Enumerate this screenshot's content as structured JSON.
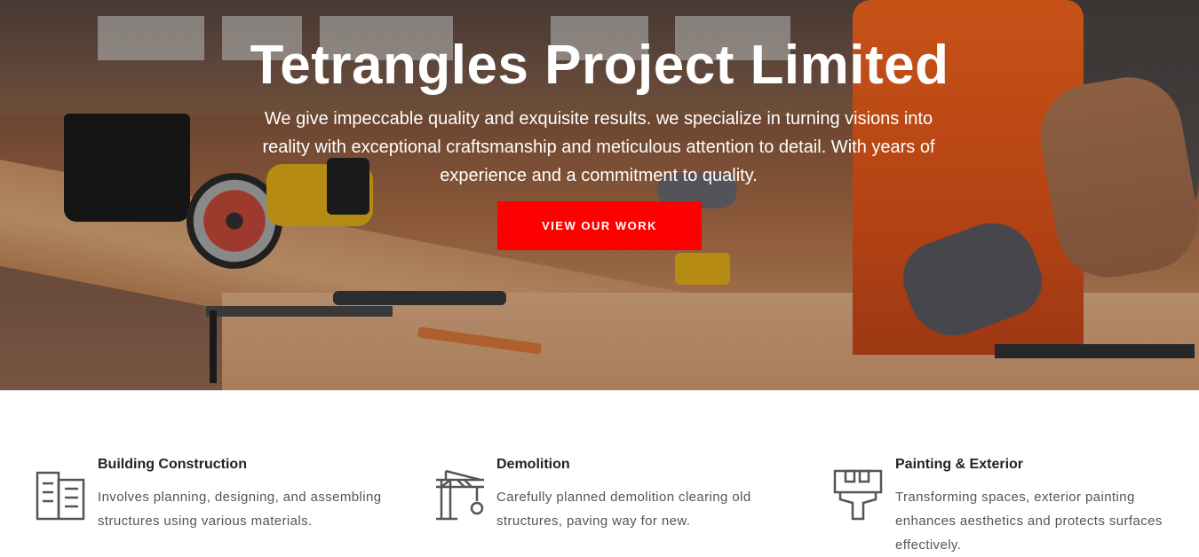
{
  "hero": {
    "title": "Tetrangles Project Limited",
    "subtitle": "We give impeccable quality and exquisite results. we specialize in turning visions into reality with exceptional craftsmanship and meticulous attention to detail. With years of experience and a commitment to quality.",
    "cta_label": "VIEW OUR WORK",
    "cta_color": "#ff0000"
  },
  "services": [
    {
      "icon": "building-icon",
      "title": "Building Construction",
      "description": "Involves planning, designing, and assembling structures using various materials."
    },
    {
      "icon": "crane-icon",
      "title": "Demolition",
      "description": "Carefully planned demolition clearing old structures, paving way for new."
    },
    {
      "icon": "paint-roller-icon",
      "title": "Painting & Exterior",
      "description": "Transforming spaces, exterior painting enhances aesthetics and protects surfaces effectively."
    }
  ]
}
